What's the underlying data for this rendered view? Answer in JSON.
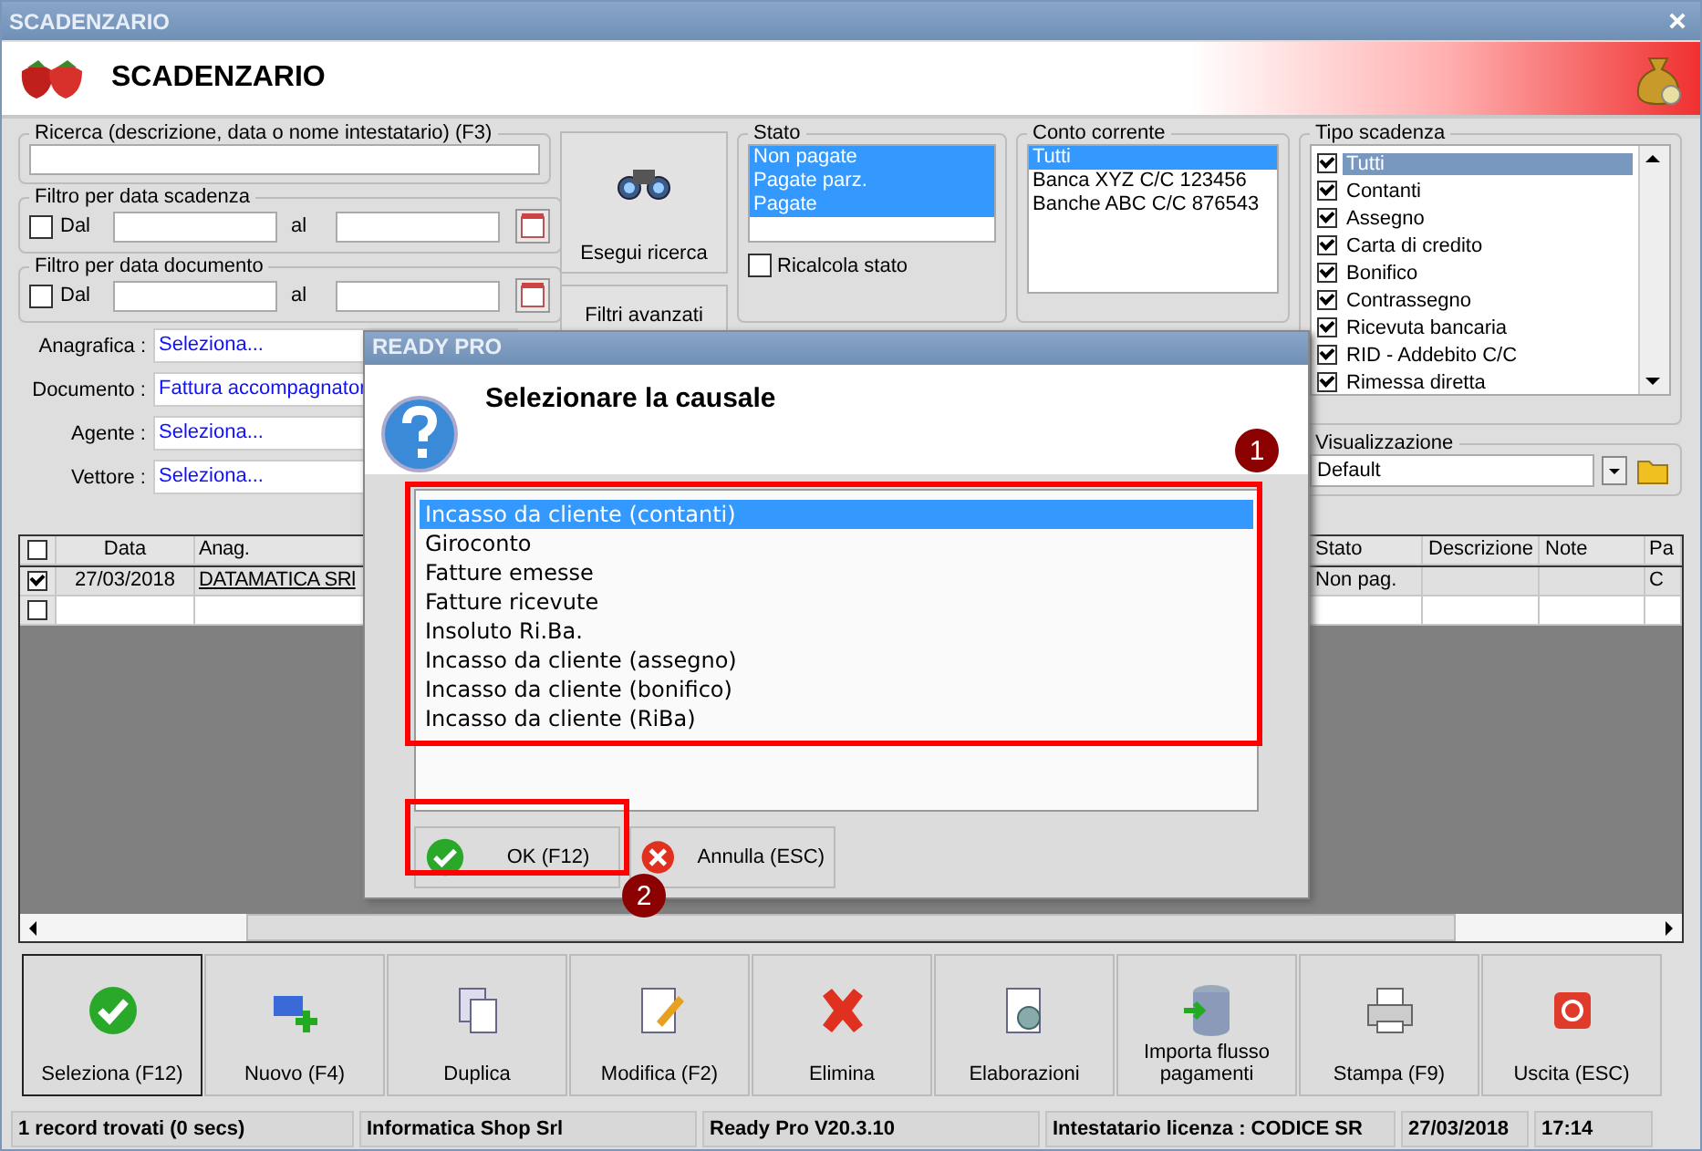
{
  "window": {
    "title": "SCADENZARIO"
  },
  "header": {
    "title": "SCADENZARIO"
  },
  "search": {
    "label": "Ricerca (descrizione, data o nome intestatario) (F3)"
  },
  "date_filters": [
    {
      "label": "Filtro per data scadenza",
      "from_label": "Dal",
      "checked": false,
      "to_label": "al"
    },
    {
      "label": "Filtro per data documento",
      "from_label": "Dal",
      "checked": false,
      "to_label": "al"
    }
  ],
  "fields": [
    {
      "label": "Anagrafica :",
      "value": "Seleziona..."
    },
    {
      "label": "Documento :",
      "value": "Fattura accompagnator"
    },
    {
      "label": "Agente :",
      "value": "Seleziona..."
    },
    {
      "label": "Vettore :",
      "value": "Seleziona..."
    }
  ],
  "side_buttons": [
    "Esegui ricerca",
    "Filtri avanzati"
  ],
  "stato": {
    "title": "Stato",
    "items": [
      {
        "label": "Non pagate",
        "selected": true
      },
      {
        "label": "Pagate parz.",
        "selected": true
      },
      {
        "label": "Pagate",
        "selected": true
      }
    ],
    "recalc": {
      "label": "Ricalcola stato",
      "checked": false
    }
  },
  "conto_corrente": {
    "title": "Conto corrente",
    "items": [
      {
        "label": "Tutti",
        "selected": true
      },
      {
        "label": "Banca XYZ C/C 123456",
        "selected": false
      },
      {
        "label": "Banche ABC C/C 876543",
        "selected": false
      }
    ]
  },
  "tipo_scadenza": {
    "title": "Tipo scadenza",
    "items": [
      {
        "label": "Tutti",
        "checked": true,
        "selected": true
      },
      {
        "label": "Contanti",
        "checked": true,
        "selected": false
      },
      {
        "label": "Assegno",
        "checked": true,
        "selected": false
      },
      {
        "label": "Carta di credito",
        "checked": true,
        "selected": false
      },
      {
        "label": "Bonifico",
        "checked": true,
        "selected": false
      },
      {
        "label": "Contrassegno",
        "checked": true,
        "selected": false
      },
      {
        "label": "Ricevuta bancaria",
        "checked": true,
        "selected": false
      },
      {
        "label": "RID - Addebito C/C",
        "checked": true,
        "selected": false
      },
      {
        "label": "Rimessa diretta",
        "checked": true,
        "selected": false
      }
    ]
  },
  "visualizzazione": {
    "title": "Visualizzazione",
    "value": "Default"
  },
  "table": {
    "header_checked": false,
    "columns": [
      "Data",
      "Anag.",
      "Stato",
      "Descrizione",
      "Note",
      "Pa"
    ],
    "rows": [
      {
        "checked": true,
        "selected": true,
        "cells": [
          "27/03/2018",
          "DATAMATICA SRl",
          "Non pag.",
          "",
          "",
          "C"
        ]
      },
      {
        "checked": false,
        "selected": false,
        "cells": [
          "",
          "",
          "",
          "",
          "",
          ""
        ]
      }
    ]
  },
  "dialog": {
    "title": "READY PRO",
    "prompt": "Selezionare la causale",
    "items": [
      {
        "label": "Incasso da cliente (contanti)",
        "selected": true
      },
      {
        "label": "Giroconto",
        "selected": false
      },
      {
        "label": "Fatture emesse",
        "selected": false
      },
      {
        "label": "Fatture ricevute",
        "selected": false
      },
      {
        "label": "Insoluto Ri.Ba.",
        "selected": false
      },
      {
        "label": "Incasso da cliente (assegno)",
        "selected": false
      },
      {
        "label": "Incasso da cliente (bonifico)",
        "selected": false
      },
      {
        "label": "Incasso da cliente (RiBa)",
        "selected": false
      }
    ],
    "buttons": [
      "OK (F12)",
      "Annulla (ESC)"
    ],
    "markers": [
      "1",
      "2"
    ]
  },
  "toolbar": [
    {
      "label": "Seleziona (F12)",
      "focused": true
    },
    {
      "label": "Nuovo (F4)",
      "focused": false
    },
    {
      "label": "Duplica",
      "focused": false
    },
    {
      "label": "Modifica (F2)",
      "focused": false
    },
    {
      "label": "Elimina",
      "focused": false
    },
    {
      "label": "Elaborazioni",
      "focused": false
    },
    {
      "label": "Importa flusso pagamenti",
      "focused": false
    },
    {
      "label": "Stampa (F9)",
      "focused": false
    },
    {
      "label": "Uscita (ESC)",
      "focused": false
    }
  ],
  "status_bar": [
    "1 record trovati (0 secs)",
    "Informatica Shop Srl",
    "Ready Pro V20.3.10",
    "Intestatario licenza : CODICE SR",
    "27/03/2018",
    "17:14"
  ]
}
